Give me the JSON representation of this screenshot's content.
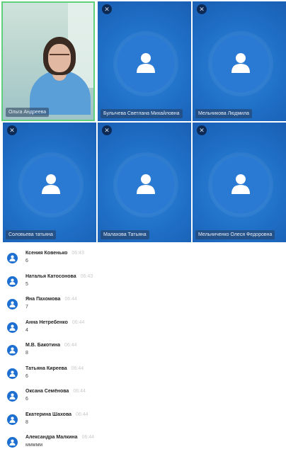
{
  "participants": [
    {
      "name": "Ольга Андреева",
      "type": "camera"
    },
    {
      "name": "Булычева Светлана Михайловна",
      "type": "avatar"
    },
    {
      "name": "Мельникова Людмила",
      "type": "avatar"
    },
    {
      "name": "Соловьева татьяна",
      "type": "avatar"
    },
    {
      "name": "Малахова Татьяна",
      "type": "avatar"
    },
    {
      "name": "Мельниченко Олеся Федоровна",
      "type": "avatar"
    }
  ],
  "chat": {
    "messages": [
      {
        "author": "Ксения Ковенько",
        "time": "06:43",
        "text": "6"
      },
      {
        "author": "Наталья Катосонова",
        "time": "06:43",
        "text": "5"
      },
      {
        "author": "Яна Пахомова",
        "time": "06:44",
        "text": "7"
      },
      {
        "author": "Анна Нетребенко",
        "time": "06:44",
        "text": "4"
      },
      {
        "author": "М.В. Бакотина",
        "time": "06:44",
        "text": "8"
      },
      {
        "author": "Татьяна Киреева",
        "time": "06:44",
        "text": "6"
      },
      {
        "author": "Оксана Семёнова",
        "time": "06:44",
        "text": "6"
      },
      {
        "author": "Екатерина Шахова",
        "time": "06:44",
        "text": "8"
      },
      {
        "author": "Александра Малкина",
        "time": "06:44",
        "text": "ммммм"
      }
    ]
  },
  "colors": {
    "tile_blue": "#1f6fc7",
    "active_border": "#5fd17a",
    "avatar_blue": "#1d6fd1"
  }
}
